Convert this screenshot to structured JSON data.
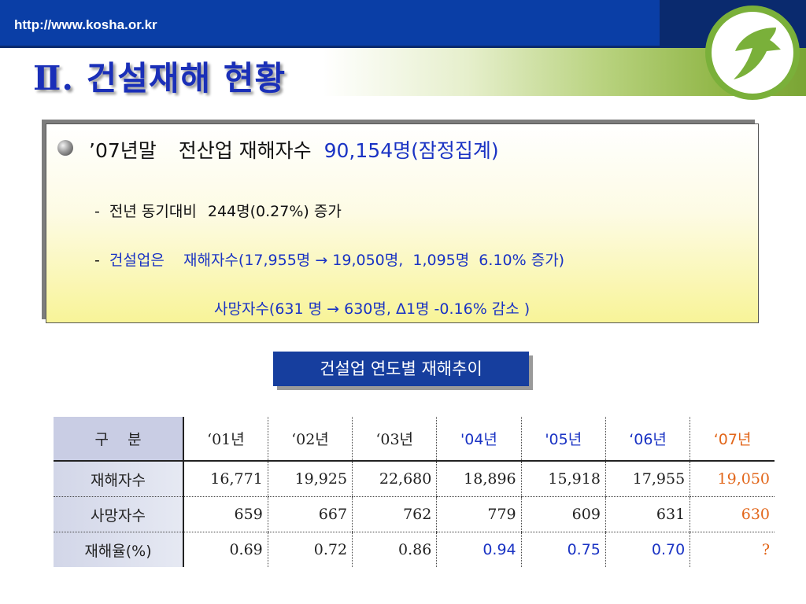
{
  "header": {
    "url": "http://www.kosha.or.kr",
    "title": "Ⅱ. 건설재해 현황"
  },
  "summary": {
    "line1_year": "’07년말",
    "line1_mid": "전산업 재해자수",
    "line1_value": "90,154명(잠정집계)",
    "line2_dash": "-",
    "line2_text": "전년 동기대비",
    "line2_value": "244명(0.27%) 증가",
    "line3_dash": "-",
    "line3_text": "건설업은    재해자수(17,955명 → 19,050명,  1,095명  6.10% 증가)",
    "line4_text": "사망자수(631 명 → 630명, Δ1명  -0.16% 감소 )"
  },
  "section_label": "건설업 연도별 재해추이",
  "table": {
    "headers": [
      "구    분",
      "‘01년",
      "‘02년",
      "‘03년",
      "'04년",
      "'05년",
      "‘06년",
      "‘07년"
    ],
    "rows": [
      {
        "label": "재해자수",
        "cells": [
          "16,771",
          "19,925",
          "22,680",
          "18,896",
          "15,918",
          "17,955",
          "19,050"
        ]
      },
      {
        "label": "사망자수",
        "cells": [
          "659",
          "667",
          "762",
          "779",
          "609",
          "631",
          "630"
        ]
      },
      {
        "label": "재해율(%)",
        "cells": [
          "0.69",
          "0.72",
          "0.86",
          "0.94",
          "0.75",
          "0.70",
          "?"
        ]
      }
    ]
  },
  "colors": {
    "title_blue": "#1a2fb8",
    "header_bar": "#0a3ea6",
    "highlight_blue": "#1a33c4",
    "highlight_orange": "#e2661a",
    "logo_green": "#7ab03a"
  },
  "icons": {
    "logo": "kosha-logo-icon",
    "bullet": "sphere-bullet-icon"
  }
}
